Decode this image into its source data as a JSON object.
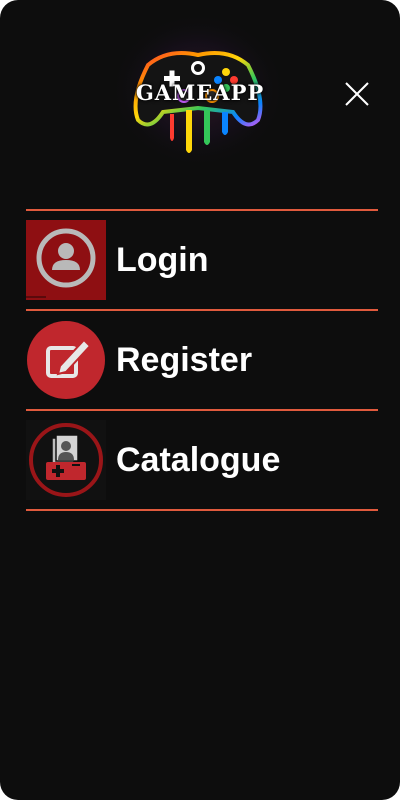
{
  "app": {
    "title": "GAMEAPP"
  },
  "icons": {
    "logo": "gamepad-logo",
    "close": "close-icon"
  },
  "colors": {
    "background": "#0d0d0d",
    "divider": "#e05a3d",
    "accent_red": "#b4232a",
    "text": "#ffffff"
  },
  "menu": {
    "items": [
      {
        "label": "Login",
        "icon": "user-circle-icon"
      },
      {
        "label": "Register",
        "icon": "edit-icon"
      },
      {
        "label": "Catalogue",
        "icon": "catalogue-icon"
      }
    ]
  }
}
